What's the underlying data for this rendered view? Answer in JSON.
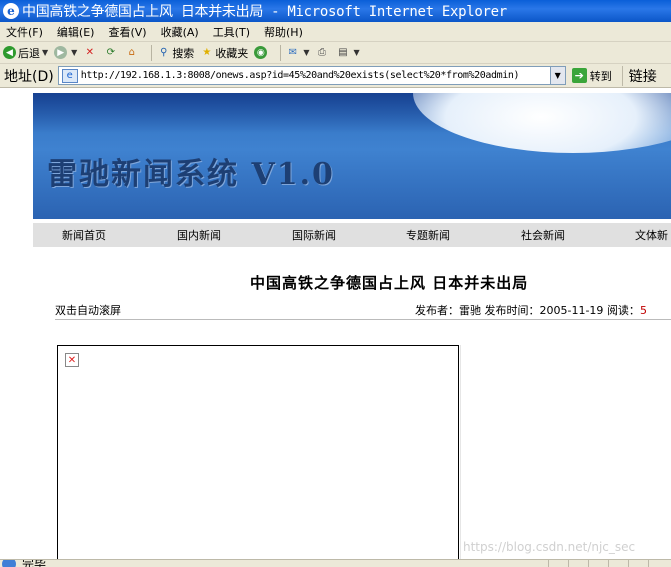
{
  "window": {
    "title": "中国高铁之争德国占上风 日本并未出局 - Microsoft Internet Explorer",
    "app_icon": "ie-icon"
  },
  "menu": [
    "文件(F)",
    "编辑(E)",
    "查看(V)",
    "收藏(A)",
    "工具(T)",
    "帮助(H)"
  ],
  "toolbar": {
    "back_label": "后退",
    "search_label": "搜索",
    "favorites_label": "收藏夹"
  },
  "address": {
    "label": "地址(D)",
    "url": "http://192.168.1.3:8008/onews.asp?id=45%20and%20exists(select%20*from%20admin)",
    "go_label": "转到",
    "links_label": "链接"
  },
  "site": {
    "brand": "雷驰新闻系统 V1.0",
    "nav": [
      "新闻首页",
      "国内新闻",
      "国际新闻",
      "专题新闻",
      "社会新闻",
      "文体新"
    ]
  },
  "article": {
    "title": "中国高铁之争德国占上风 日本并未出局",
    "autoscroll": "双击自动滚屏",
    "publisher_label": "发布者：",
    "publisher": "雷驰",
    "time_label": "发布时间：",
    "time": "2005-11-19",
    "reads_label": "阅读：",
    "reads": "5"
  },
  "watermark": "https://blog.csdn.net/njc_sec",
  "status": {
    "text": "完毕"
  },
  "colors": {
    "titlebar": "#0a5fd8",
    "chrome": "#ece9d8",
    "banner": "#2f6fbf",
    "navbar": "#e0e0e0"
  }
}
